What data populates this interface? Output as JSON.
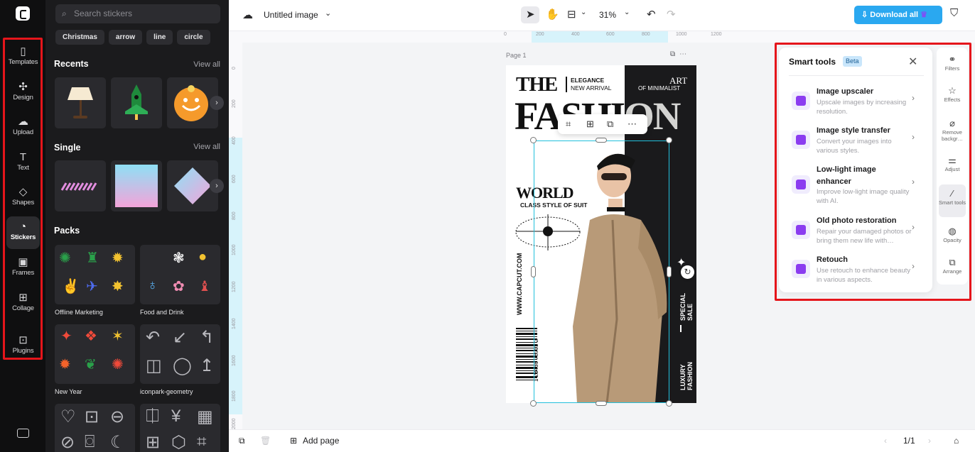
{
  "rail": {
    "items": [
      {
        "label": "Templates",
        "icon": "▯"
      },
      {
        "label": "Design",
        "icon": "✣"
      },
      {
        "label": "Upload",
        "icon": "☁"
      },
      {
        "label": "Text",
        "icon": "T"
      },
      {
        "label": "Shapes",
        "icon": "◇"
      },
      {
        "label": "Stickers",
        "icon": "◔"
      },
      {
        "label": "Frames",
        "icon": "▣"
      },
      {
        "label": "Collage",
        "icon": "⊞"
      },
      {
        "label": "Plugins",
        "icon": "⊡"
      }
    ]
  },
  "stickers": {
    "search_placeholder": "Search stickers",
    "chips": [
      "Christmas",
      "arrow",
      "line",
      "circle"
    ],
    "recents_title": "Recents",
    "single_title": "Single",
    "packs_title": "Packs",
    "view_all": "View all",
    "packs": [
      "Offline Marketing",
      "Food and Drink",
      "New Year",
      "iconpark-geometry"
    ]
  },
  "topbar": {
    "doc_title": "Untitled image",
    "zoom": "31%",
    "download_label": "Download all"
  },
  "ruler": {
    "h_ticks": [
      "0",
      "200",
      "400",
      "600",
      "800",
      "1000",
      "1200"
    ],
    "v_ticks": [
      "0",
      "200",
      "400",
      "600",
      "800",
      "1000",
      "1200",
      "1400",
      "1600",
      "1800",
      "2000"
    ]
  },
  "canvas": {
    "page_label": "Page 1",
    "poster": {
      "the": "THE",
      "elegance": "ELEGANCE",
      "new_arrival": "NEW ARRIVAL",
      "art": "ART",
      "of_minimalist": "OF MINIMALIST",
      "fashion": "FASHION",
      "world": "WORLD",
      "class_style": "CLASS STYLE OF SUIT",
      "website": "WWW.CAPCUT.COM",
      "barcode_number": "1 23456 78901 2",
      "special_sale": "SPECIAL SALE",
      "luxury": "LUXURY FASHION"
    }
  },
  "smart_tools": {
    "title": "Smart tools",
    "badge": "Beta",
    "tools": [
      {
        "title": "Image upscaler",
        "desc": "Upscale images by increasing resolution."
      },
      {
        "title": "Image style transfer",
        "desc": "Convert your images into various styles."
      },
      {
        "title": "Low-light image enhancer",
        "desc": "Improve low-light image quality with AI."
      },
      {
        "title": "Old photo restoration",
        "desc": "Repair your damaged photos or bring them new life with…"
      },
      {
        "title": "Retouch",
        "desc": "Use retouch to enhance beauty in various aspects."
      }
    ]
  },
  "right_rail": {
    "items": [
      {
        "label": "Filters",
        "icon": "⚭"
      },
      {
        "label": "Effects",
        "icon": "☆"
      },
      {
        "label": "Remove backgr…",
        "icon": "⌀"
      },
      {
        "label": "Adjust",
        "icon": "⚌"
      },
      {
        "label": "Smart tools",
        "icon": "⁄"
      },
      {
        "label": "Opacity",
        "icon": "◍"
      },
      {
        "label": "Arrange",
        "icon": "⧉"
      }
    ]
  },
  "bottombar": {
    "add_page": "Add page",
    "page_count": "1/1"
  }
}
